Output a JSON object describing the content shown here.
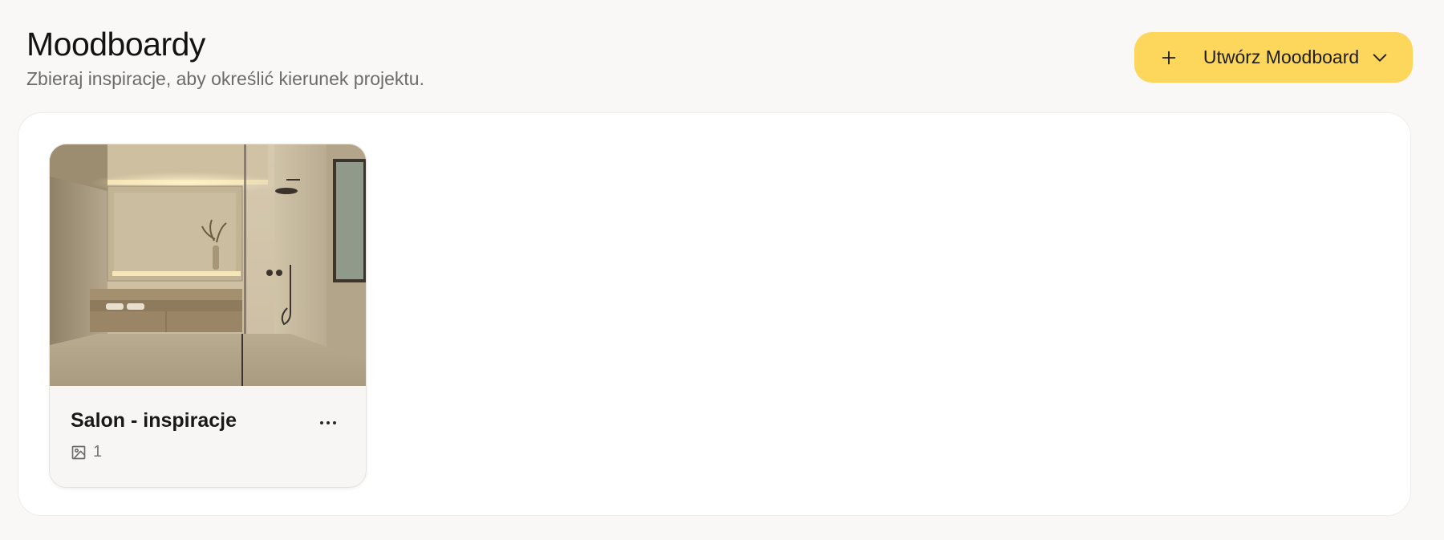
{
  "header": {
    "title": "Moodboardy",
    "subtitle": "Zbieraj inspiracje, aby określić kierunek projektu."
  },
  "actions": {
    "create_label": "Utwórz Moodboard",
    "create_icon": "plus-icon",
    "dropdown_icon": "chevron-down-icon",
    "accent_color": "#fdd65c"
  },
  "moodboards": [
    {
      "title": "Salon - inspiracje",
      "image_count": "1",
      "thumbnail": "bathroom interior photo",
      "menu_icon": "more-horizontal-icon",
      "count_icon": "image-icon"
    }
  ]
}
